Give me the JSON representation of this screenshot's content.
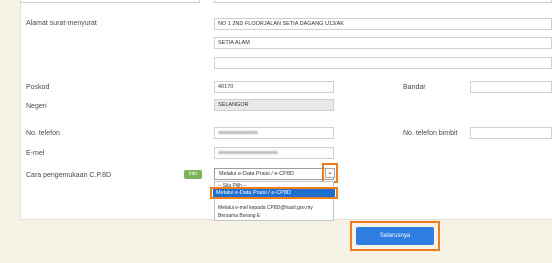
{
  "form": {
    "alamat": {
      "label": "Alamat surat-menyurat",
      "line1": "NO 1 2ND FLOORJALAN SETIA DAGANG U13/AK",
      "line2": "SETIA ALAM",
      "line3": ""
    },
    "poskod": {
      "label": "Poskod",
      "value": "40170"
    },
    "bandar": {
      "label": "Bandar"
    },
    "negeri": {
      "label": "Negeri",
      "value": "SELANGOR"
    },
    "telefon": {
      "label": "No. telefon"
    },
    "telefon_bimbit": {
      "label": "No. telefon bimbit"
    },
    "emel": {
      "label": "E-mel"
    },
    "cara": {
      "label": "Cara pengemukaan C.P.8D",
      "info_label": "Info",
      "selected_value": "Melalui e-Data Praisi / e-CP8D",
      "caret": "⌄",
      "options": [
        "-- Sila Pilih --",
        "Melalui e-Data Praisi / e-CP8D",
        "Melalui e-mel kepada CP8D@hasil.gov.my",
        "Bersama Borang E"
      ]
    }
  },
  "actions": {
    "next_label": "Seterusnya"
  },
  "colors": {
    "highlight": "#f07c20",
    "primary": "#2f7de0",
    "info": "#7ab35a"
  }
}
